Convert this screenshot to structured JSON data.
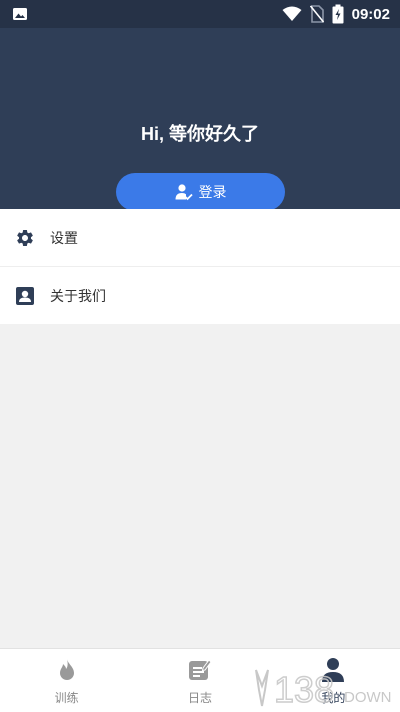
{
  "status_bar": {
    "time": "09:02",
    "icons": [
      "image-icon",
      "wifi-icon",
      "no-sim-icon",
      "battery-charging-icon"
    ]
  },
  "header": {
    "greeting": "Hi, 等你好久了",
    "login_label": "登录",
    "colors": {
      "background": "#2f3e57",
      "button": "#3b7ae8"
    }
  },
  "menu": {
    "items": [
      {
        "label": "设置",
        "icon": "gear-icon"
      },
      {
        "label": "关于我们",
        "icon": "contact-card-icon"
      }
    ]
  },
  "bottom_nav": {
    "items": [
      {
        "label": "训练",
        "icon": "flame-icon",
        "active": false
      },
      {
        "label": "日志",
        "icon": "note-edit-icon",
        "active": false
      },
      {
        "label": "我的",
        "icon": "person-icon",
        "active": true
      }
    ]
  },
  "watermark": {
    "text": "138DOWN"
  }
}
